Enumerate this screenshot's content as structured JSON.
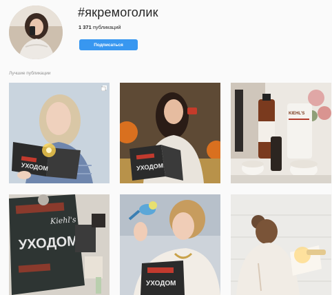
{
  "header": {
    "hashtag": "#якремоголик",
    "posts_count_number": "1 371",
    "posts_count_label": "публикаций",
    "follow_label": "Подписаться"
  },
  "section": {
    "top_posts_label": "Лучшие публикации"
  },
  "posts": [
    {
      "label": "Пост: девушка с книгой",
      "book_title": "УХОДОМ"
    },
    {
      "label": "Пост: девушка с книгой и кремом",
      "book_title": "УХОДОМ"
    },
    {
      "label": "Пост: средства Kiehl's",
      "brand": "KIEHL'S"
    },
    {
      "label": "Пост: книга Kiehl's",
      "book_title": "УХОДОМ",
      "brand": "Kiehl's"
    },
    {
      "label": "Пост: девушка с попугаем",
      "book_title": "УХОДОМ"
    },
    {
      "label": "Пост: девушка с книгой у окна"
    }
  ],
  "colors": {
    "accent": "#3897f0",
    "background": "#fafafa",
    "muted_text": "#8e8e8e"
  }
}
